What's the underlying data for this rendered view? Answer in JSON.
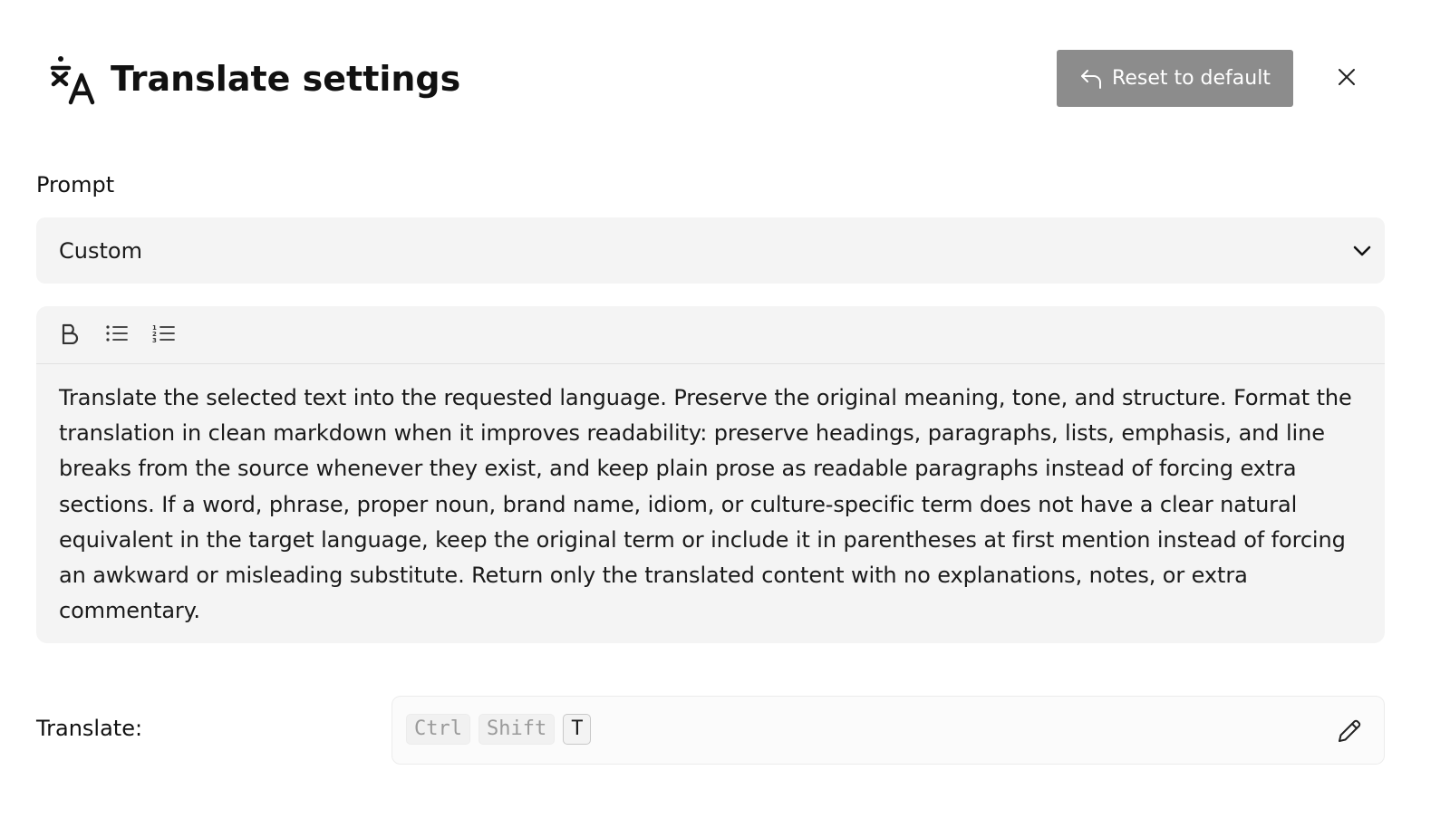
{
  "header": {
    "title": "Translate settings",
    "reset_label": "Reset to default",
    "icons": {
      "title": "translate-icon",
      "reset": "undo-arrow-icon",
      "close": "close-icon"
    }
  },
  "prompt": {
    "label": "Prompt",
    "selected": "Custom"
  },
  "editor": {
    "toolbar": [
      "bold-icon",
      "bullet-list-icon",
      "numbered-list-icon"
    ],
    "text": "Translate the selected text into the requested language. Preserve the original meaning, tone, and structure. Format the translation in clean markdown when it improves readability: preserve headings, paragraphs, lists, emphasis, and line breaks from the source whenever they exist, and keep plain prose as readable paragraphs instead of forcing extra sections. If a word, phrase, proper noun, brand name, idiom, or culture-specific term does not have a clear natural equivalent in the target language, keep the original term or include it in parentheses at first mention instead of forcing an awkward or misleading substitute. Return only the translated content with no explanations, notes, or extra commentary."
  },
  "shortcut": {
    "label": "Translate:",
    "keys": [
      "Ctrl",
      "Shift",
      "T"
    ],
    "edit_icon": "pencil-icon"
  },
  "colors": {
    "reset_bg": "#8c8c8c",
    "panel_bg": "#f4f4f4"
  }
}
